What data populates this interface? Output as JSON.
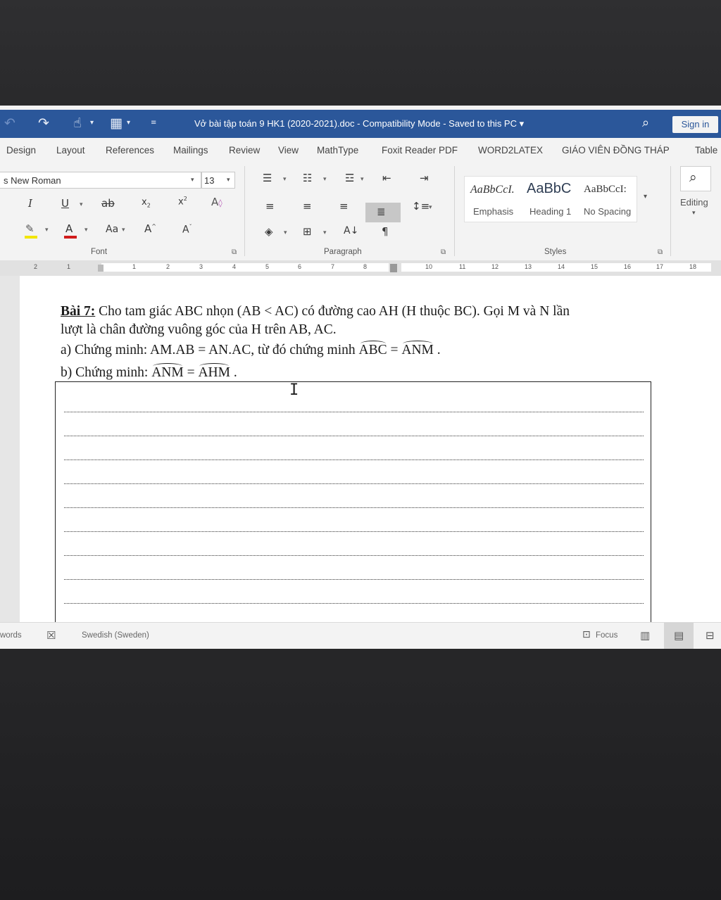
{
  "window": {
    "title": "Vở bài tập toán 9 HK1 (2020-2021).doc  -  Compatibility Mode  -  Saved to this PC  ▾",
    "sign_in": "Sign in"
  },
  "tabs": [
    "Design",
    "Layout",
    "References",
    "Mailings",
    "Review",
    "View",
    "MathType",
    "Foxit Reader PDF",
    "WORD2LATEX",
    "GIÁO VIÊN ĐỒNG THÁP",
    "Table"
  ],
  "ribbon": {
    "font_name": "s New Roman",
    "font_size": "13",
    "groups": {
      "font": "Font",
      "paragraph": "Paragraph",
      "styles": "Styles"
    },
    "styles": [
      {
        "sample": "AaBbCcI.",
        "name": "Emphasis"
      },
      {
        "sample": "AaBbC",
        "name": "Heading 1"
      },
      {
        "sample": "AaBbCcI:",
        "name": "No Spacing"
      }
    ],
    "editing": "Editing",
    "font_color": "#d01c1c",
    "highlight_color": "#f2e600",
    "accent": "#2b579a"
  },
  "ruler": {
    "left_numbers": [
      "2",
      "1"
    ],
    "numbers": [
      "1",
      "2",
      "3",
      "4",
      "5",
      "6",
      "7",
      "8"
    ],
    "right_numbers": [
      "10",
      "11",
      "12",
      "13",
      "14",
      "15",
      "16",
      "17",
      "18"
    ]
  },
  "document": {
    "exercise_label": "Bài 7:",
    "line1": " Cho tam giác ABC nhọn (AB < AC) có đường cao AH (H thuộc BC). Gọi M và N lần",
    "line2": "lượt là chân đường vuông góc của H trên AB, AC.",
    "part_a_prefix": "a) Chứng minh: AM.AB = AN.AC, từ đó chứng minh ",
    "part_a_angle1": "ABC",
    "part_a_eq": " = ",
    "part_a_angle2": "ANM",
    "part_a_end": " .",
    "part_b_prefix": "b) Chứng minh:  ",
    "part_b_angle1": "ANM",
    "part_b_eq": " = ",
    "part_b_angle2": "AHM",
    "part_b_end": " ."
  },
  "statusbar": {
    "words": "words",
    "language": "Swedish (Sweden)",
    "focus": "Focus"
  }
}
